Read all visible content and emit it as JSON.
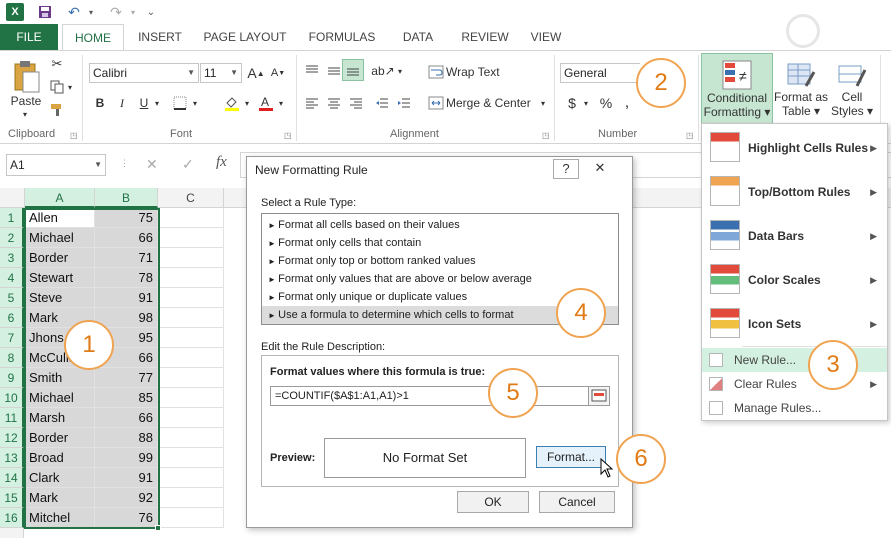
{
  "tabs": [
    "FILE",
    "HOME",
    "INSERT",
    "PAGE LAYOUT",
    "FORMULAS",
    "DATA",
    "REVIEW",
    "VIEW"
  ],
  "ribbon": {
    "paste": "Paste",
    "clipboard": "Clipboard",
    "font_name": "Calibri",
    "font_size": "11",
    "font_group": "Font",
    "wrap_text": "Wrap Text",
    "merge_center": "Merge & Center",
    "alignment_group": "Alignment",
    "number_format": "General",
    "number_group": "Number",
    "conditional_formatting": [
      "Conditional",
      "Formatting"
    ],
    "format_as_table": [
      "Format as",
      "Table"
    ],
    "cell_styles": [
      "Cell",
      "Styles"
    ]
  },
  "name_box": "A1",
  "columns": [
    "A",
    "B",
    "C"
  ],
  "rows": [
    {
      "n": "1",
      "name": "Allen",
      "val": "75"
    },
    {
      "n": "2",
      "name": "Michael",
      "val": "66"
    },
    {
      "n": "3",
      "name": "Border",
      "val": "71"
    },
    {
      "n": "4",
      "name": "Stewart",
      "val": "78"
    },
    {
      "n": "5",
      "name": "Steve",
      "val": "91"
    },
    {
      "n": "6",
      "name": "Mark",
      "val": "98"
    },
    {
      "n": "7",
      "name": "Jhons",
      "val": "95"
    },
    {
      "n": "8",
      "name": "McCulla",
      "val": "66"
    },
    {
      "n": "9",
      "name": "Smith",
      "val": "77"
    },
    {
      "n": "10",
      "name": "Michael",
      "val": "85"
    },
    {
      "n": "11",
      "name": "Marsh",
      "val": "66"
    },
    {
      "n": "12",
      "name": "Border",
      "val": "88"
    },
    {
      "n": "13",
      "name": "Broad",
      "val": "99"
    },
    {
      "n": "14",
      "name": "Clark",
      "val": "91"
    },
    {
      "n": "15",
      "name": "Mark",
      "val": "92"
    },
    {
      "n": "16",
      "name": "Mitchel",
      "val": "76"
    }
  ],
  "dialog": {
    "title": "New Formatting Rule",
    "help": "?",
    "close": "✕",
    "select_rule_type": "Select a Rule Type:",
    "rule_types": [
      "Format all cells based on their values",
      "Format only cells that contain",
      "Format only top or bottom ranked values",
      "Format only values that are above or below average",
      "Format only unique or duplicate values",
      "Use a formula to determine which cells to format"
    ],
    "edit_description": "Edit the Rule Description:",
    "formula_label": "Format values where this formula is true:",
    "formula_value": "=COUNTIF($A$1:A1,A1)>1",
    "preview_label": "Preview:",
    "preview_text": "No Format Set",
    "format_button": "Format...",
    "ok": "OK",
    "cancel": "Cancel"
  },
  "cf_menu": {
    "big_items": [
      "Highlight Cells Rules",
      "Top/Bottom Rules",
      "Data Bars",
      "Color Scales",
      "Icon Sets"
    ],
    "small_items": [
      "New Rule...",
      "Clear Rules",
      "Manage Rules..."
    ]
  },
  "callouts": [
    "1",
    "2",
    "3",
    "4",
    "5",
    "6"
  ]
}
